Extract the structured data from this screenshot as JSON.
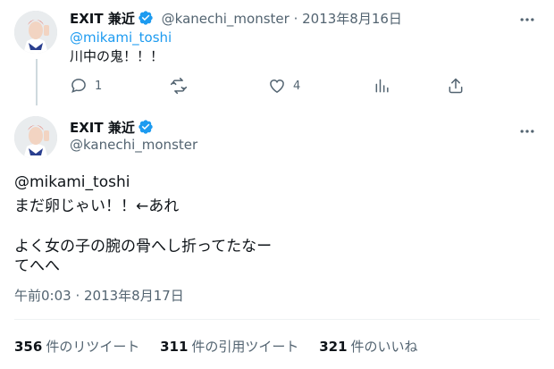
{
  "colors": {
    "accent": "#1d9bf0",
    "muted": "#536471",
    "text": "#0f1419"
  },
  "reply_tweet": {
    "author_name": "EXIT 兼近",
    "handle": "@kanechi_monster",
    "date": "· 2013年8月16日",
    "mention": "@mikami_toshi",
    "text": "川中の鬼！！！",
    "actions": {
      "reply_count": "1",
      "retweet_count": "",
      "like_count": "4"
    }
  },
  "main_tweet": {
    "author_name": "EXIT 兼近",
    "handle": "@kanechi_monster",
    "mention": "@mikami_toshi",
    "line1": "まだ卵じゃい！！←あれ",
    "line2": "よく女の子の腕の骨へし折ってたなー",
    "line3": "てへへ",
    "timestamp": "午前0:03 · 2013年8月17日"
  },
  "stats": {
    "retweets_count": "356",
    "retweets_label": "件のリツイート",
    "quotes_count": "311",
    "quotes_label": "件の引用ツイート",
    "likes_count": "321",
    "likes_label": "件のいいね"
  },
  "icons": {
    "verified": "verified-badge-icon",
    "more": "more-horizontal-icon",
    "reply": "reply-bubble-icon",
    "retweet": "retweet-icon",
    "like": "heart-icon",
    "analytics": "bar-chart-icon",
    "share": "share-upload-icon"
  }
}
